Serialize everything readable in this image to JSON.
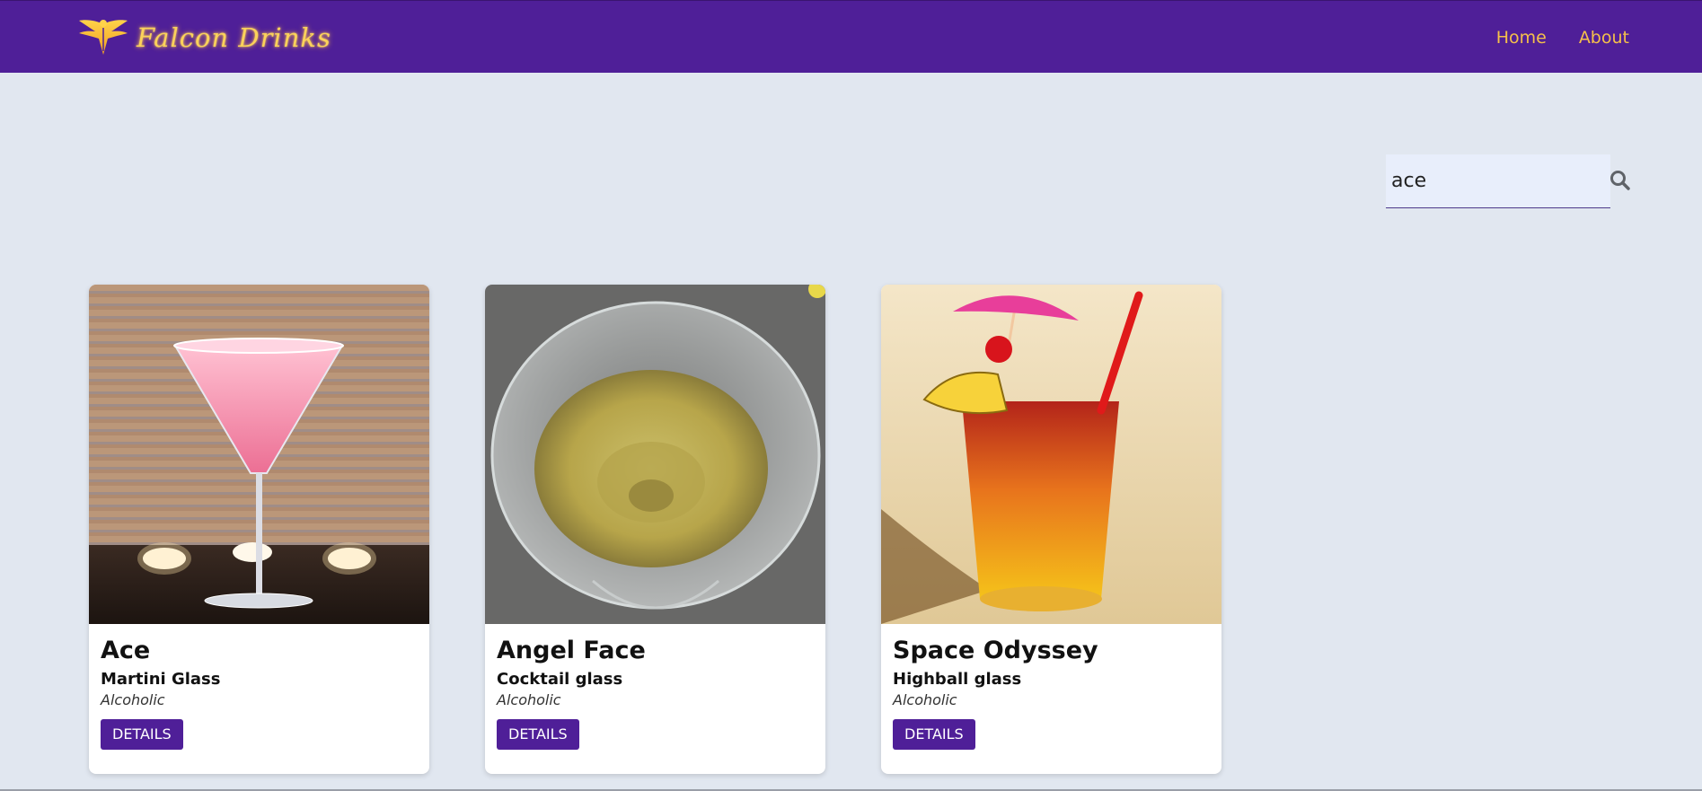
{
  "nav": {
    "brand": "Falcon Drinks",
    "logo_icon": "falcon-logo-icon",
    "links": [
      "Home",
      "About"
    ]
  },
  "search": {
    "value": "ace",
    "icon": "search-icon"
  },
  "cards": [
    {
      "title": "Ace",
      "glass": "Martini Glass",
      "type": "Alcoholic",
      "button": "DETAILS"
    },
    {
      "title": "Angel Face",
      "glass": "Cocktail glass",
      "type": "Alcoholic",
      "button": "DETAILS"
    },
    {
      "title": "Space Odyssey",
      "glass": "Highball glass",
      "type": "Alcoholic",
      "button": "DETAILS"
    }
  ],
  "colors": {
    "navbar": "#4f1f98",
    "nav_link": "#f5c04a",
    "brand_text": "#fbd25a",
    "page_bg": "#e1e7f0",
    "button": "#4f1f98"
  }
}
